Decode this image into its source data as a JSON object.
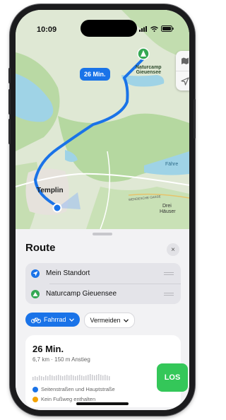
{
  "status_bar": {
    "time": "10:09"
  },
  "map": {
    "eta_label": "26 Min.",
    "destination_label_line1": "Naturcamp",
    "destination_label_line2": "Gieuensee",
    "town_label": "Templin",
    "place_label_faehre": "Fähre",
    "place_label_drei": "Drei",
    "place_label_haeuser": "Häuser",
    "road_label": "WENDESCHE GASSE"
  },
  "sheet": {
    "title": "Route",
    "close_icon": "×",
    "stops": [
      {
        "label": "Mein Standort",
        "icon": "location-arrow-icon",
        "color": "#1a73e8"
      },
      {
        "label": "Naturcamp Gieuensee",
        "icon": "camp-icon",
        "color": "#34a853"
      }
    ],
    "chips": [
      {
        "label": "Fahrrad",
        "active": true
      },
      {
        "label": "Vermeiden",
        "active": false
      }
    ],
    "route_card": {
      "duration": "26 Min.",
      "details": "6,7 km · 150 m Anstieg",
      "info1": "Seitenstraßen und Hauptstraße",
      "info2": "Kein Fußweg enthalten",
      "go_label": "LOS"
    }
  },
  "colors": {
    "accent": "#1a73e8",
    "go": "#34c759",
    "warning": "#f4a300"
  }
}
